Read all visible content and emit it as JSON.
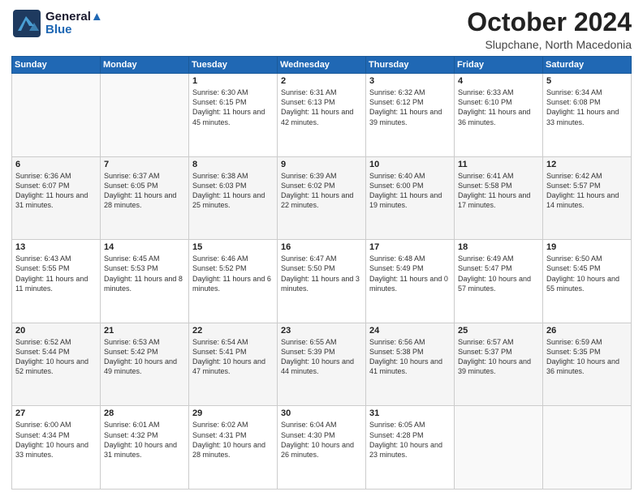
{
  "logo": {
    "line1": "General",
    "line2": "Blue"
  },
  "header": {
    "title": "October 2024",
    "subtitle": "Slupchane, North Macedonia"
  },
  "weekdays": [
    "Sunday",
    "Monday",
    "Tuesday",
    "Wednesday",
    "Thursday",
    "Friday",
    "Saturday"
  ],
  "weeks": [
    [
      {
        "day": "",
        "info": ""
      },
      {
        "day": "",
        "info": ""
      },
      {
        "day": "1",
        "info": "Sunrise: 6:30 AM\nSunset: 6:15 PM\nDaylight: 11 hours and 45 minutes."
      },
      {
        "day": "2",
        "info": "Sunrise: 6:31 AM\nSunset: 6:13 PM\nDaylight: 11 hours and 42 minutes."
      },
      {
        "day": "3",
        "info": "Sunrise: 6:32 AM\nSunset: 6:12 PM\nDaylight: 11 hours and 39 minutes."
      },
      {
        "day": "4",
        "info": "Sunrise: 6:33 AM\nSunset: 6:10 PM\nDaylight: 11 hours and 36 minutes."
      },
      {
        "day": "5",
        "info": "Sunrise: 6:34 AM\nSunset: 6:08 PM\nDaylight: 11 hours and 33 minutes."
      }
    ],
    [
      {
        "day": "6",
        "info": "Sunrise: 6:36 AM\nSunset: 6:07 PM\nDaylight: 11 hours and 31 minutes."
      },
      {
        "day": "7",
        "info": "Sunrise: 6:37 AM\nSunset: 6:05 PM\nDaylight: 11 hours and 28 minutes."
      },
      {
        "day": "8",
        "info": "Sunrise: 6:38 AM\nSunset: 6:03 PM\nDaylight: 11 hours and 25 minutes."
      },
      {
        "day": "9",
        "info": "Sunrise: 6:39 AM\nSunset: 6:02 PM\nDaylight: 11 hours and 22 minutes."
      },
      {
        "day": "10",
        "info": "Sunrise: 6:40 AM\nSunset: 6:00 PM\nDaylight: 11 hours and 19 minutes."
      },
      {
        "day": "11",
        "info": "Sunrise: 6:41 AM\nSunset: 5:58 PM\nDaylight: 11 hours and 17 minutes."
      },
      {
        "day": "12",
        "info": "Sunrise: 6:42 AM\nSunset: 5:57 PM\nDaylight: 11 hours and 14 minutes."
      }
    ],
    [
      {
        "day": "13",
        "info": "Sunrise: 6:43 AM\nSunset: 5:55 PM\nDaylight: 11 hours and 11 minutes."
      },
      {
        "day": "14",
        "info": "Sunrise: 6:45 AM\nSunset: 5:53 PM\nDaylight: 11 hours and 8 minutes."
      },
      {
        "day": "15",
        "info": "Sunrise: 6:46 AM\nSunset: 5:52 PM\nDaylight: 11 hours and 6 minutes."
      },
      {
        "day": "16",
        "info": "Sunrise: 6:47 AM\nSunset: 5:50 PM\nDaylight: 11 hours and 3 minutes."
      },
      {
        "day": "17",
        "info": "Sunrise: 6:48 AM\nSunset: 5:49 PM\nDaylight: 11 hours and 0 minutes."
      },
      {
        "day": "18",
        "info": "Sunrise: 6:49 AM\nSunset: 5:47 PM\nDaylight: 10 hours and 57 minutes."
      },
      {
        "day": "19",
        "info": "Sunrise: 6:50 AM\nSunset: 5:45 PM\nDaylight: 10 hours and 55 minutes."
      }
    ],
    [
      {
        "day": "20",
        "info": "Sunrise: 6:52 AM\nSunset: 5:44 PM\nDaylight: 10 hours and 52 minutes."
      },
      {
        "day": "21",
        "info": "Sunrise: 6:53 AM\nSunset: 5:42 PM\nDaylight: 10 hours and 49 minutes."
      },
      {
        "day": "22",
        "info": "Sunrise: 6:54 AM\nSunset: 5:41 PM\nDaylight: 10 hours and 47 minutes."
      },
      {
        "day": "23",
        "info": "Sunrise: 6:55 AM\nSunset: 5:39 PM\nDaylight: 10 hours and 44 minutes."
      },
      {
        "day": "24",
        "info": "Sunrise: 6:56 AM\nSunset: 5:38 PM\nDaylight: 10 hours and 41 minutes."
      },
      {
        "day": "25",
        "info": "Sunrise: 6:57 AM\nSunset: 5:37 PM\nDaylight: 10 hours and 39 minutes."
      },
      {
        "day": "26",
        "info": "Sunrise: 6:59 AM\nSunset: 5:35 PM\nDaylight: 10 hours and 36 minutes."
      }
    ],
    [
      {
        "day": "27",
        "info": "Sunrise: 6:00 AM\nSunset: 4:34 PM\nDaylight: 10 hours and 33 minutes."
      },
      {
        "day": "28",
        "info": "Sunrise: 6:01 AM\nSunset: 4:32 PM\nDaylight: 10 hours and 31 minutes."
      },
      {
        "day": "29",
        "info": "Sunrise: 6:02 AM\nSunset: 4:31 PM\nDaylight: 10 hours and 28 minutes."
      },
      {
        "day": "30",
        "info": "Sunrise: 6:04 AM\nSunset: 4:30 PM\nDaylight: 10 hours and 26 minutes."
      },
      {
        "day": "31",
        "info": "Sunrise: 6:05 AM\nSunset: 4:28 PM\nDaylight: 10 hours and 23 minutes."
      },
      {
        "day": "",
        "info": ""
      },
      {
        "day": "",
        "info": ""
      }
    ]
  ]
}
